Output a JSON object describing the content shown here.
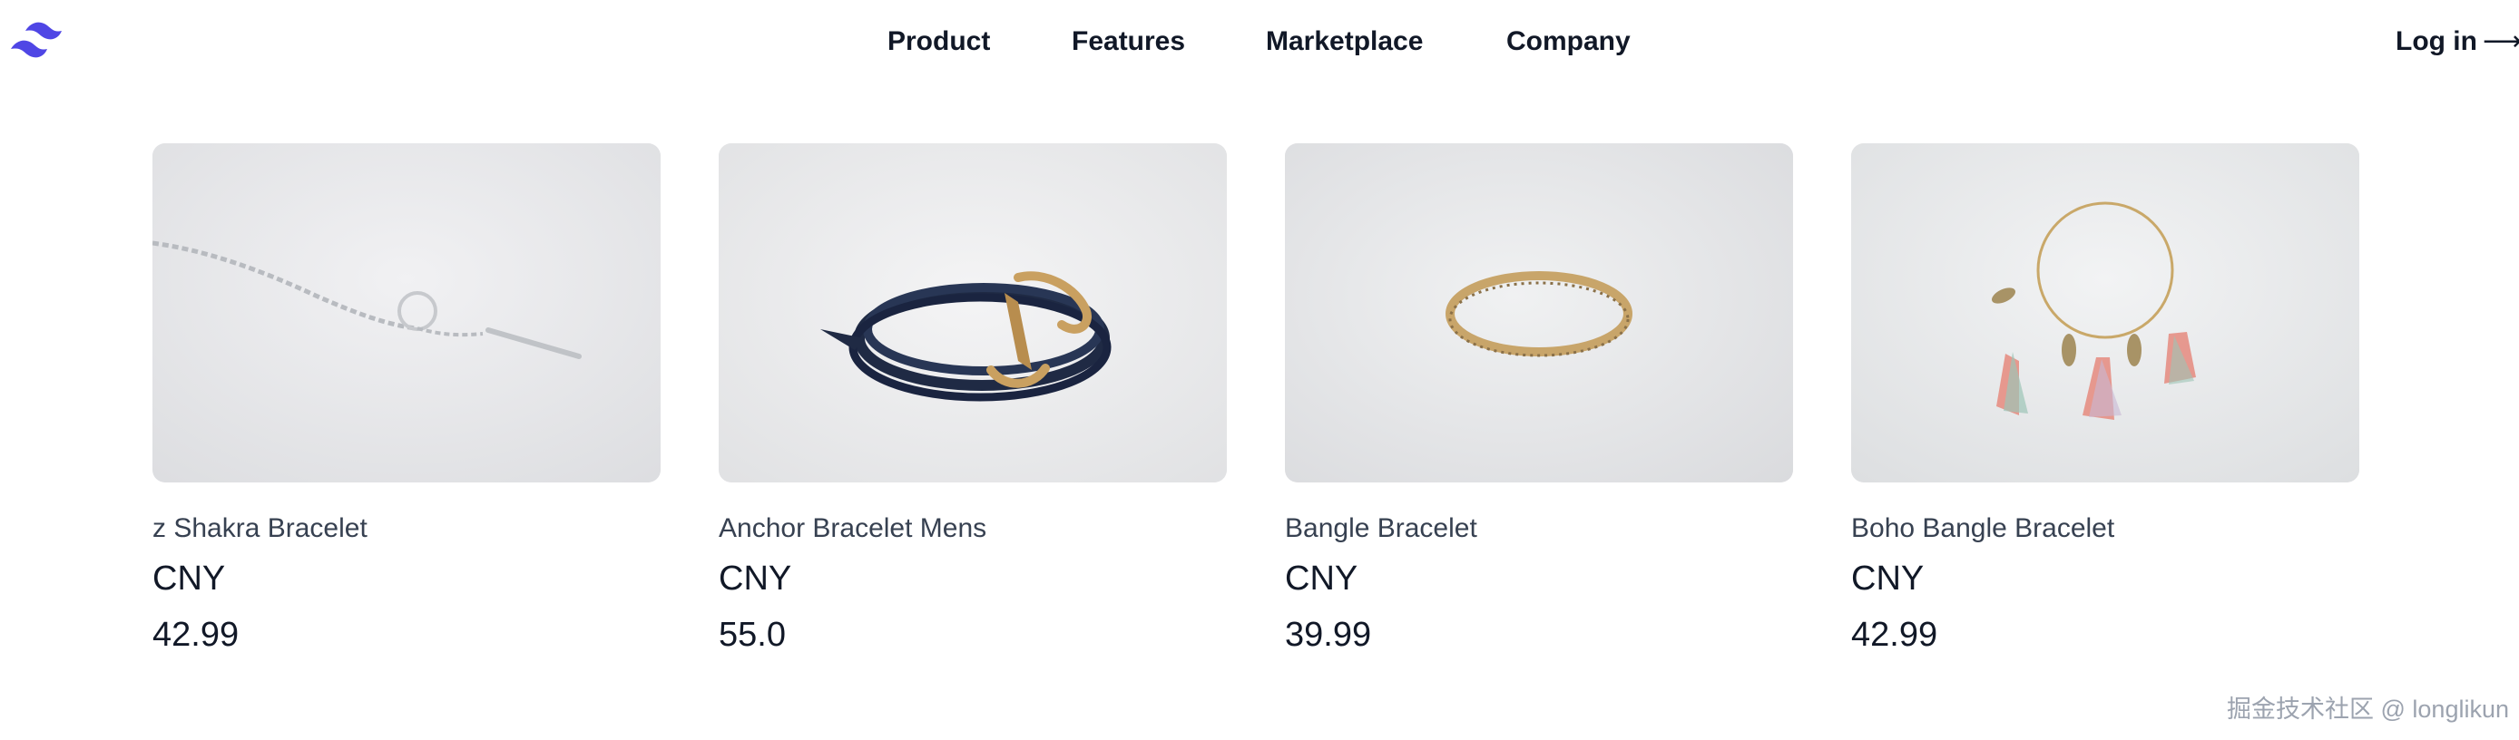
{
  "brand": {
    "logo_icon": "tailwind-wave-logo-icon",
    "color": "#4f46e5"
  },
  "nav": {
    "items": [
      {
        "label": "Product"
      },
      {
        "label": "Features"
      },
      {
        "label": "Marketplace"
      },
      {
        "label": "Company"
      }
    ],
    "login_label": "Log in",
    "login_arrow": "⟶"
  },
  "products": [
    {
      "name": "z Shakra Bracelet",
      "currency": "CNY",
      "price": "42.99",
      "image_icon": "silver-chain-bracelet-image"
    },
    {
      "name": "Anchor Bracelet Mens",
      "currency": "CNY",
      "price": "55.0",
      "image_icon": "navy-anchor-bracelet-image"
    },
    {
      "name": "Bangle Bracelet",
      "currency": "CNY",
      "price": "39.99",
      "image_icon": "gold-bangle-image"
    },
    {
      "name": "Boho Bangle Bracelet",
      "currency": "CNY",
      "price": "42.99",
      "image_icon": "boho-tassel-bangle-image"
    }
  ],
  "watermark": "掘金技术社区 @ longlikun"
}
